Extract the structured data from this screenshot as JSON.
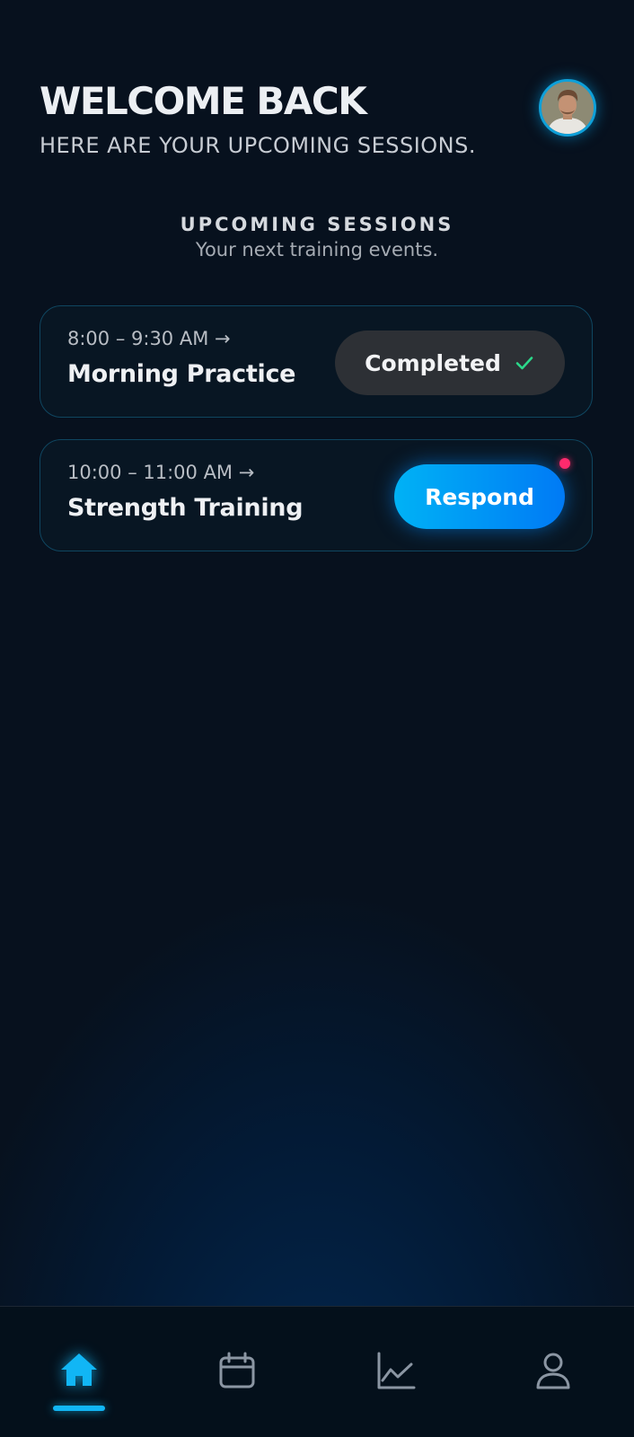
{
  "header": {
    "title": "WELCOME BACK",
    "subtitle": "HERE ARE YOUR UPCOMING SESSIONS."
  },
  "section": {
    "title": "UPCOMING SESSIONS",
    "subtitle": "Your next training events."
  },
  "sessions": [
    {
      "time": "8:00 – 9:30 AM →",
      "title": "Morning Practice",
      "status": "completed",
      "action_label": "Completed",
      "action_icon": "check-icon"
    },
    {
      "time": "10:00 – 11:00 AM →",
      "title": "Strength Training",
      "status": "pending",
      "action_label": "Respond",
      "has_notification": true
    }
  ],
  "nav": {
    "items": [
      {
        "icon": "home-icon",
        "active": true
      },
      {
        "icon": "calendar-icon",
        "active": false
      },
      {
        "icon": "chart-line-icon",
        "active": false
      },
      {
        "icon": "user-icon",
        "active": false
      }
    ]
  },
  "colors": {
    "accent": "#11b6f5",
    "check": "#2bd88a",
    "notification": "#ff2a6d",
    "respond_gradient_start": "#00b2f5",
    "respond_gradient_end": "#007af5"
  }
}
